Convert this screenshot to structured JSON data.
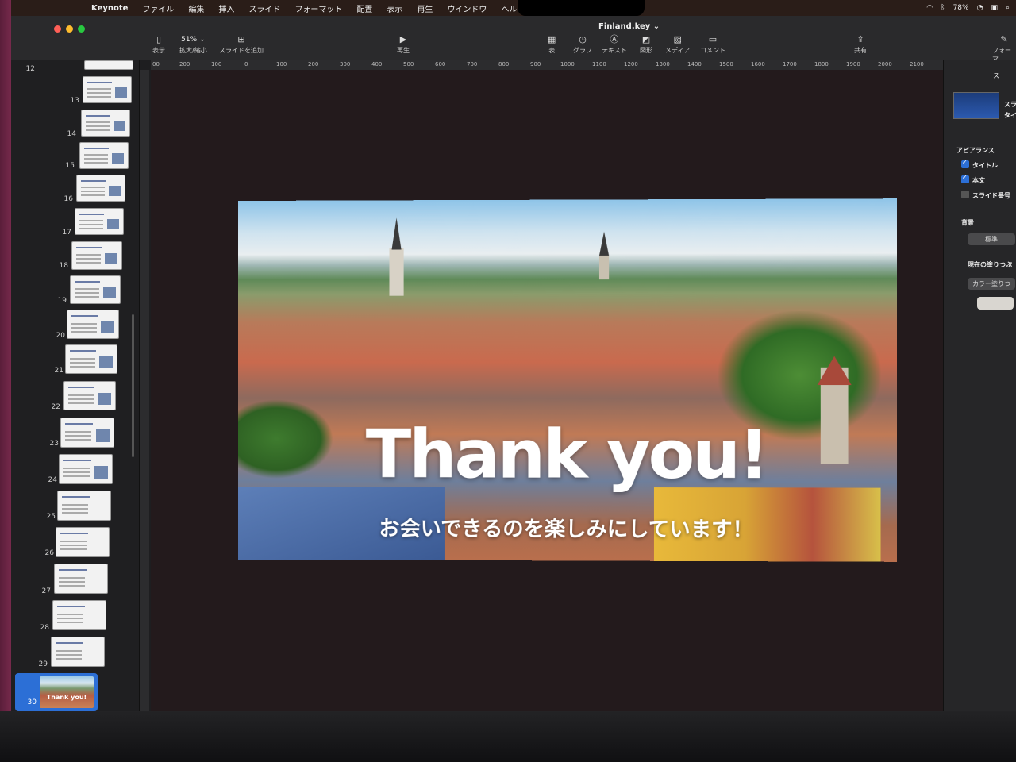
{
  "menubar": {
    "items": [
      "Keynote",
      "ファイル",
      "編集",
      "挿入",
      "スライド",
      "フォーマット",
      "配置",
      "表示",
      "再生",
      "ウインドウ",
      "ヘルプ"
    ],
    "battery": "78%"
  },
  "toolbar": {
    "document_title": "Finland.key",
    "zoom_value": "51%",
    "view_label": "表示",
    "zoom_label": "拡大/縮小",
    "add_slide_label": "スライドを追加",
    "play_label": "再生",
    "table_label": "表",
    "chart_label": "グラフ",
    "text_label": "テキスト",
    "shape_label": "図形",
    "media_label": "メディア",
    "comment_label": "コメント",
    "share_label": "共有",
    "format_label": "フォーマ"
  },
  "ruler": [
    "00",
    "200",
    "100",
    "0",
    "100",
    "200",
    "300",
    "400",
    "500",
    "600",
    "700",
    "800",
    "900",
    "1000",
    "1100",
    "1200",
    "1300",
    "1400",
    "1500",
    "1600",
    "1700",
    "1800",
    "1900",
    "2000",
    "2100"
  ],
  "navigator": {
    "slide_numbers": [
      "12",
      "13",
      "14",
      "15",
      "16",
      "17",
      "18",
      "19",
      "20",
      "21",
      "22",
      "23",
      "24",
      "25",
      "26",
      "27",
      "28",
      "29",
      "30"
    ],
    "selected_slide": "30",
    "selected_thumb_text": "Thank you!"
  },
  "slide": {
    "title": "Thank you!",
    "subtitle": "お会いできるのを楽しみにしています！"
  },
  "inspector": {
    "tab_label": "ス",
    "layout_name_1": "スラ",
    "layout_name_2": "タイ",
    "appearance_heading": "アピアランス",
    "title_checkbox": "タイトル",
    "body_checkbox": "本文",
    "slide_number_checkbox": "スライド番号",
    "background_heading": "背景",
    "background_button": "標準",
    "current_fill_heading": "現在の塗りつぶ",
    "fill_type_button": "カラー塗りつ"
  },
  "colors": {
    "accent": "#2c6fd6",
    "close": "#ff5f57",
    "minimize": "#febc2e",
    "zoom": "#28c840"
  }
}
